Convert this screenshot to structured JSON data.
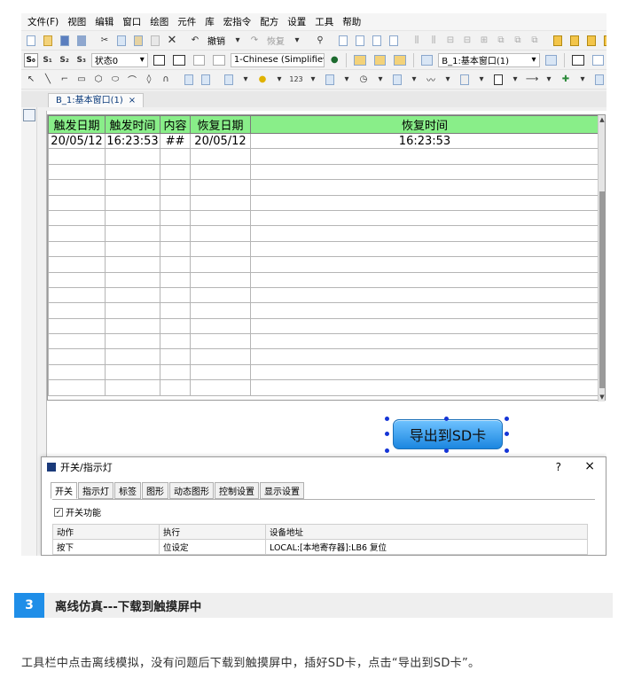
{
  "screenshot": {
    "menu": [
      "文件(F)",
      "视图",
      "编辑",
      "窗口",
      "绘图",
      "元件",
      "库",
      "宏指令",
      "配方",
      "设置",
      "工具",
      "帮助"
    ],
    "toolbar1": {
      "undo_label": "撤销",
      "redo_label": "恢复"
    },
    "toolbar2": {
      "state_label": "S₀",
      "state1": "S₁",
      "state2": "S₂",
      "state3": "S₃",
      "state_combo": "状态0",
      "lang_combo": "1-Chinese (Simplifie",
      "window_combo": "B_1:基本窗口(1)"
    },
    "tab": {
      "label": "B_1:基本窗口(1)",
      "close": "×"
    },
    "alarm_table": {
      "headers": [
        "触发日期",
        "触发时间",
        "内容",
        "恢复日期",
        "恢复时间"
      ],
      "row1": [
        "20/05/12",
        "16:23:53",
        "##",
        "20/05/12",
        "16:23:53"
      ],
      "empty_rows": 16
    },
    "export_button": "导出到SD卡",
    "dialog": {
      "title": "开关/指示灯",
      "help": "?",
      "close": "×",
      "tabs": [
        "开关",
        "指示灯",
        "标签",
        "图形",
        "动态图形",
        "控制设置",
        "显示设置"
      ],
      "checkbox_label": "开关功能",
      "table_headers": [
        "动作",
        "执行",
        "设备地址"
      ],
      "table_row": [
        "按下",
        "位设定",
        "LOCAL:[本地寄存器]:LB6 复位"
      ]
    }
  },
  "section": {
    "number": "3",
    "title": "离线仿真---下载到触摸屏中"
  },
  "body_text": "工具栏中点击离线模拟，没有问题后下载到触摸屏中，插好SD卡，点击“导出到SD卡”。"
}
